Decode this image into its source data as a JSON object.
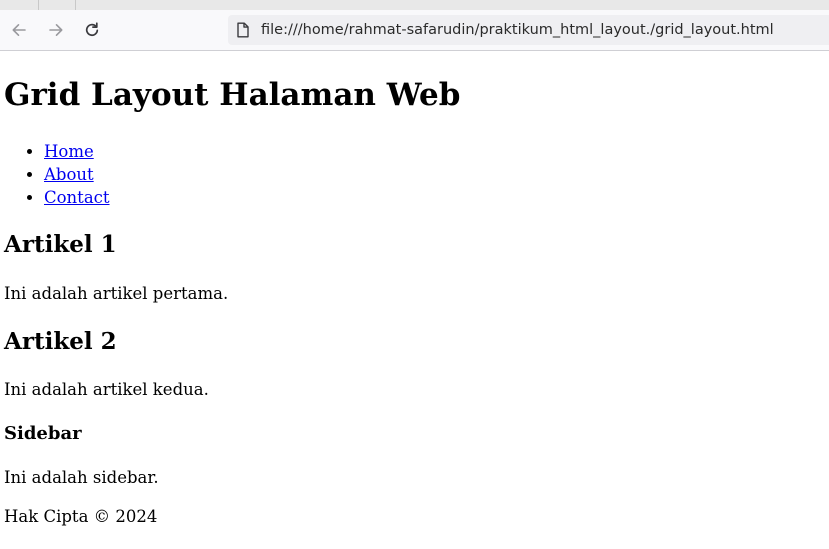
{
  "browser": {
    "address_bar": "file:///home/rahmat-safarudin/praktikum_html_layout./grid_layout.html"
  },
  "page": {
    "title": "Grid Layout Halaman Web",
    "nav": [
      {
        "label": "Home"
      },
      {
        "label": "About"
      },
      {
        "label": "Contact"
      }
    ],
    "articles": [
      {
        "heading": "Artikel 1",
        "body": "Ini adalah artikel pertama."
      },
      {
        "heading": "Artikel 2",
        "body": "Ini adalah artikel kedua."
      }
    ],
    "sidebar": {
      "heading": "Sidebar",
      "body": "Ini adalah sidebar."
    },
    "footer": "Hak Cipta © 2024"
  }
}
